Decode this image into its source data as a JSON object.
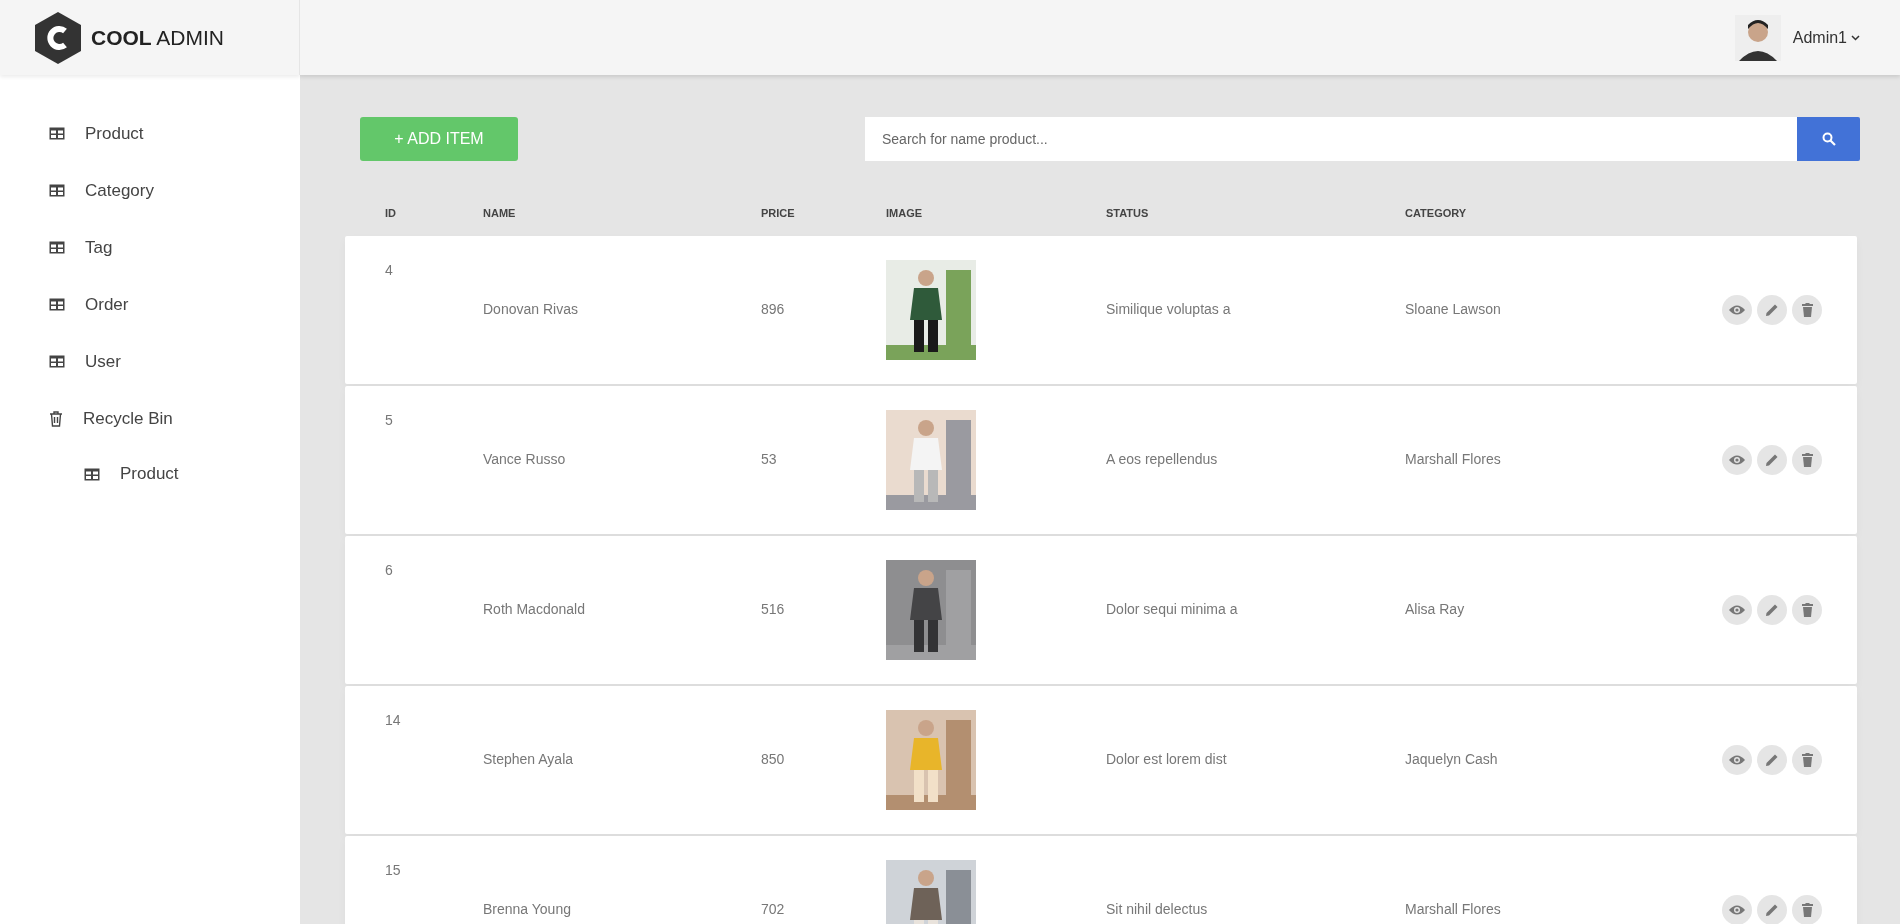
{
  "logo": {
    "bold": "COOL",
    "light": "ADMIN"
  },
  "user": {
    "name": "Admin1"
  },
  "sidebar": {
    "items": [
      {
        "label": "Product",
        "kind": "table"
      },
      {
        "label": "Category",
        "kind": "table"
      },
      {
        "label": "Tag",
        "kind": "table"
      },
      {
        "label": "Order",
        "kind": "table"
      },
      {
        "label": "User",
        "kind": "table"
      },
      {
        "label": "Recycle Bin",
        "kind": "trash",
        "children": [
          {
            "label": "Product",
            "kind": "table"
          }
        ]
      }
    ]
  },
  "toolbar": {
    "add_button": "+ ADD ITEM",
    "search": {
      "placeholder": "Search for name product..."
    }
  },
  "table": {
    "columns": [
      "ID",
      "NAME",
      "PRICE",
      "IMAGE",
      "STATUS",
      "CATEGORY"
    ],
    "rows": [
      {
        "id": "4",
        "name": "Donovan Rivas",
        "price": "896",
        "status": "Similique voluptas a",
        "category": "Sloane Lawson"
      },
      {
        "id": "5",
        "name": "Vance Russo",
        "price": "53",
        "status": "A eos repellendus",
        "category": "Marshall Flores"
      },
      {
        "id": "6",
        "name": "Roth Macdonald",
        "price": "516",
        "status": "Dolor sequi minima a",
        "category": "Alisa Ray"
      },
      {
        "id": "14",
        "name": "Stephen Ayala",
        "price": "850",
        "status": "Dolor est lorem dist",
        "category": "Jaquelyn Cash"
      },
      {
        "id": "15",
        "name": "Brenna Young",
        "price": "702",
        "status": "Sit nihil delectus",
        "category": "Marshall Flores"
      }
    ]
  }
}
